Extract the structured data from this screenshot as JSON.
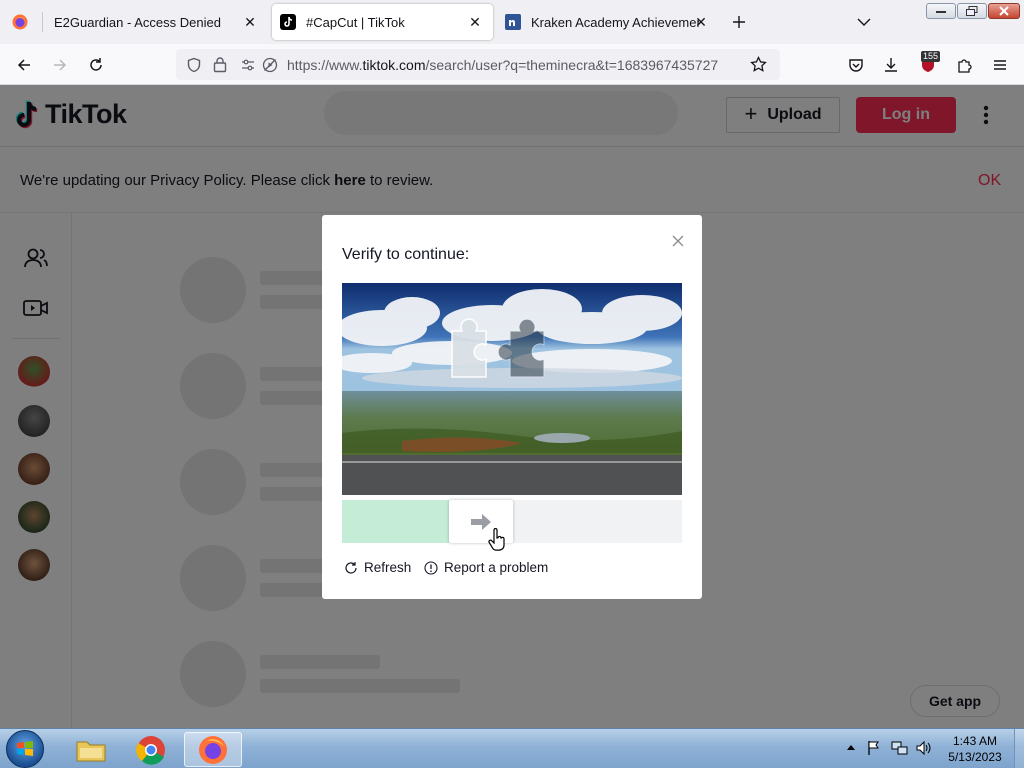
{
  "browser": {
    "tabs": [
      {
        "title": "E2Guardian - Access Denied"
      },
      {
        "title": "#CapCut | TikTok",
        "active": true
      },
      {
        "title": "Kraken Academy Achievements"
      }
    ],
    "url_prefix": "https://www.",
    "url_domain": "tiktok.com",
    "url_path": "/search/user?q=theminecra&t=1683967435727",
    "extension_badge": "155"
  },
  "tiktok": {
    "logo_text": "TikTok",
    "upload_label": "Upload",
    "login_label": "Log in",
    "banner": {
      "text_before": "We're updating our Privacy Policy. Please click ",
      "link": "here",
      "text_after": " to review.",
      "ok_label": "OK"
    },
    "get_app_label": "Get app"
  },
  "captcha": {
    "title": "Verify to continue:",
    "slider_progress": 0.31,
    "refresh_label": "Refresh",
    "report_label": "Report a problem"
  },
  "taskbar": {
    "time": "1:43 AM",
    "date": "5/13/2023"
  },
  "colors": {
    "brand": "#fe2c55",
    "slider_fill": "#c5ecd7"
  }
}
